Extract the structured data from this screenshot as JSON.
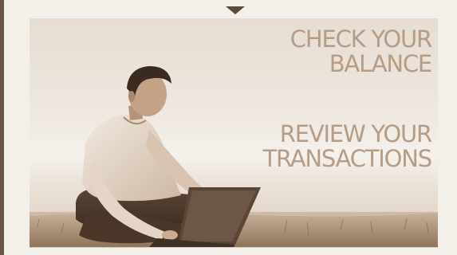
{
  "banner": {
    "links": [
      {
        "label": [
          "CHECK YOUR",
          "BALANCE"
        ]
      },
      {
        "label": [
          "REVIEW YOUR",
          "TRANSACTIONS"
        ]
      }
    ],
    "image": "man-with-laptop-in-field"
  },
  "colors": {
    "accent": "#5c4a3d",
    "text": "#b69c85",
    "sepia_dark": "#6a5444",
    "background": "#f3efe9"
  }
}
